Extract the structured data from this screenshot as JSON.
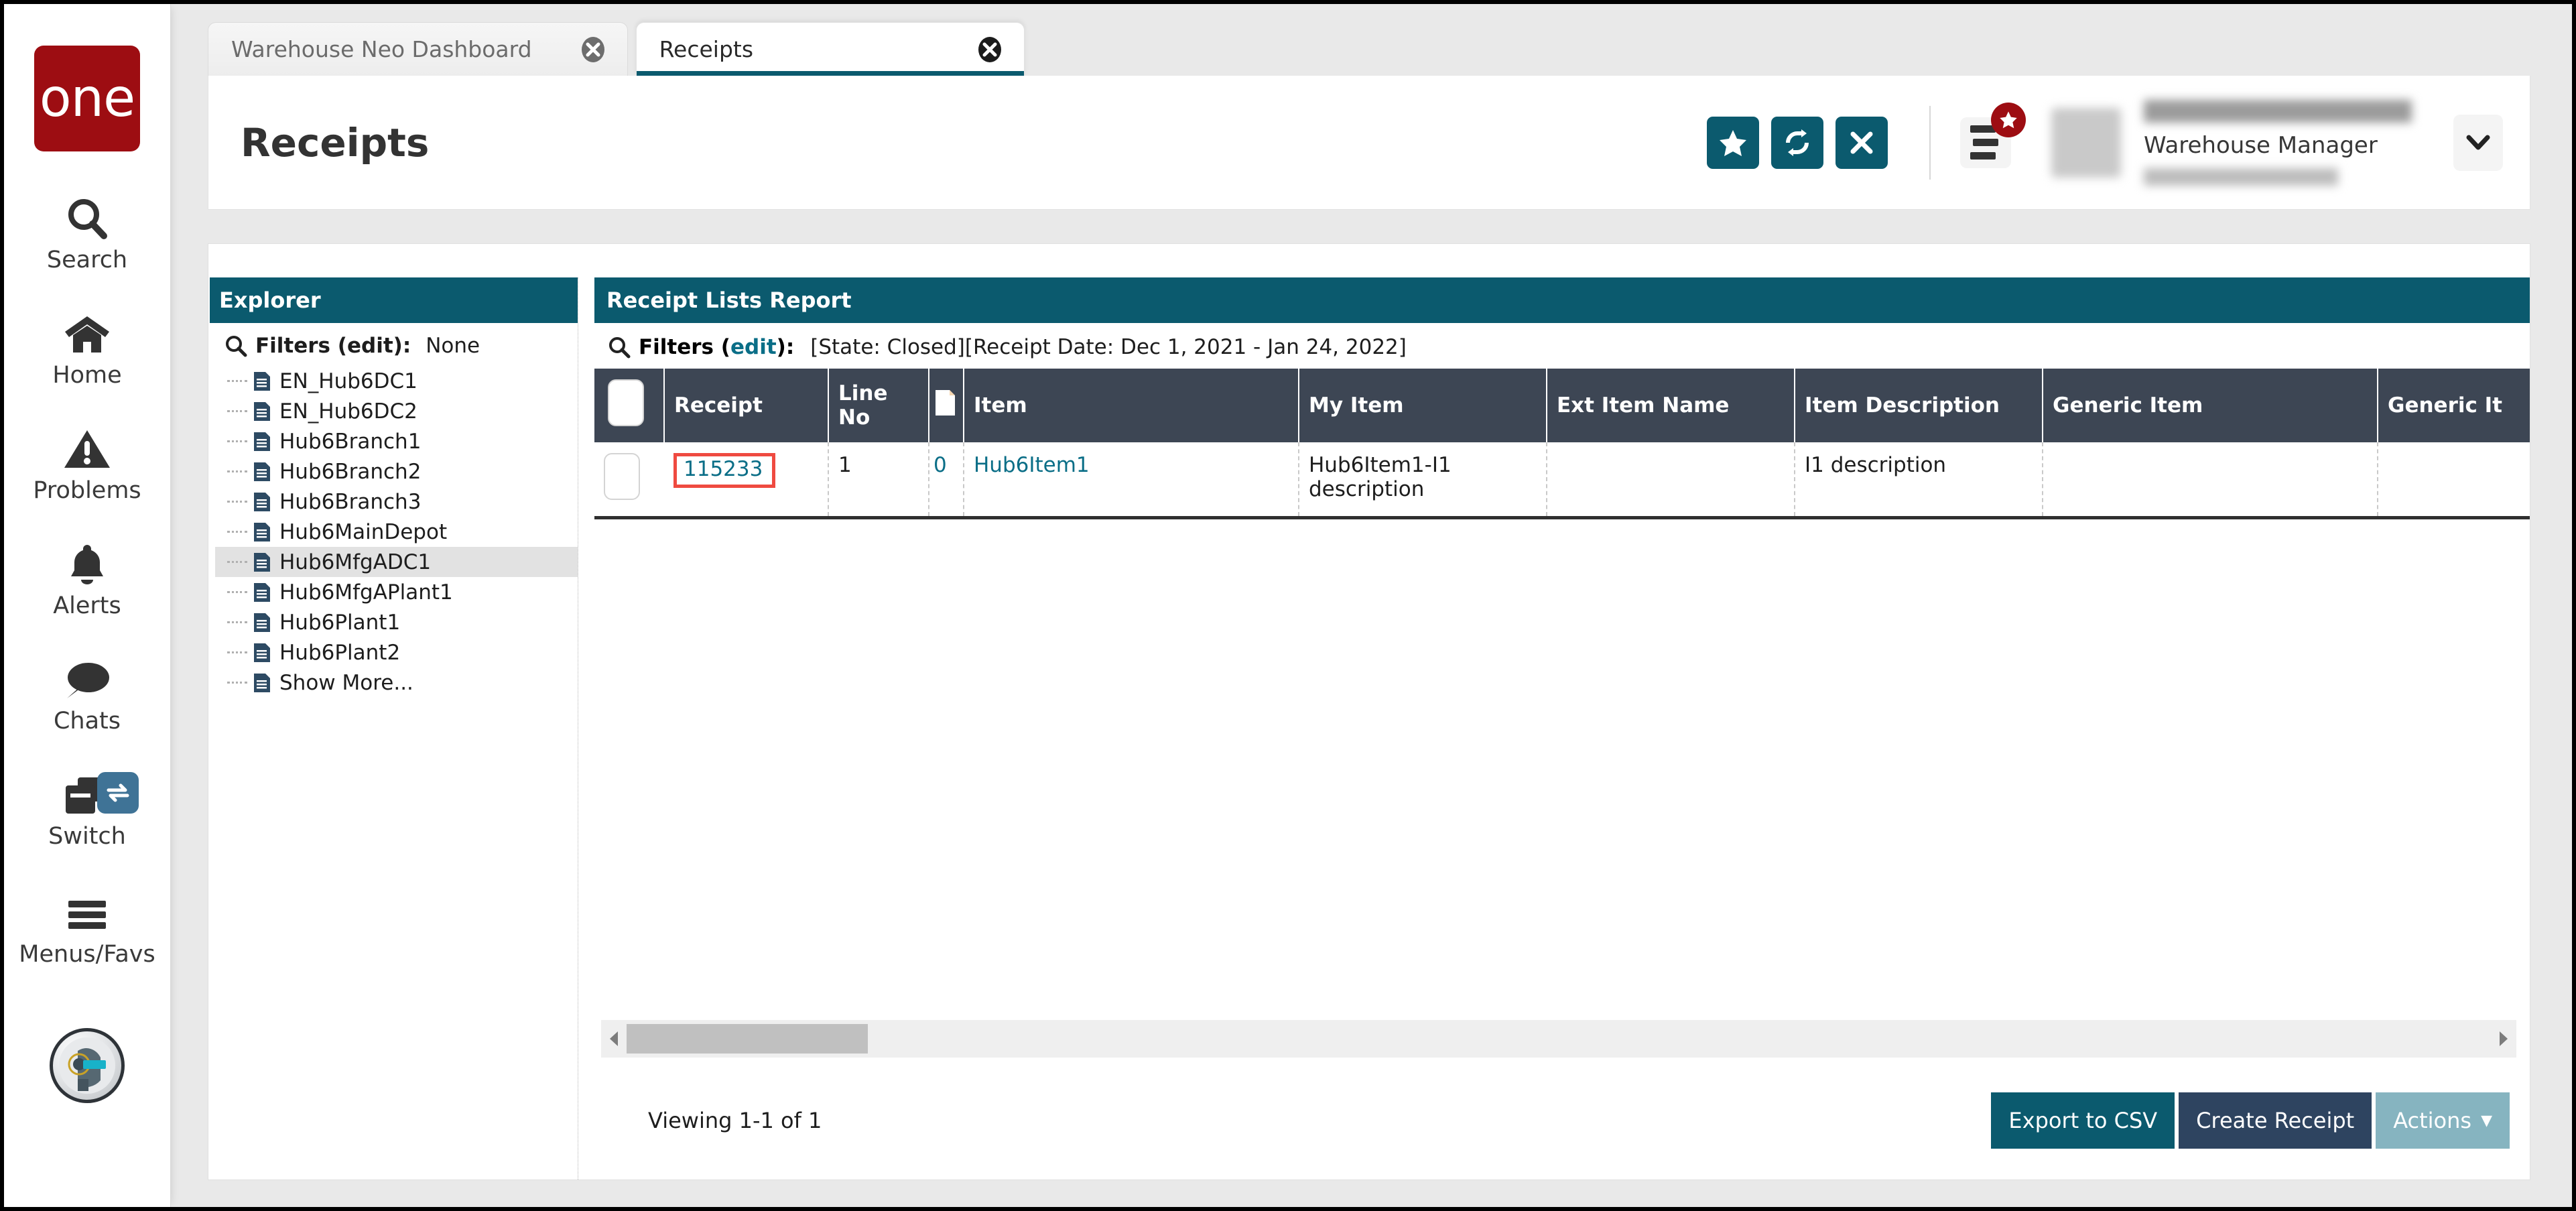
{
  "brand": {
    "logo_text": "one"
  },
  "rail": {
    "items": [
      {
        "label": "Search",
        "icon": "search-icon"
      },
      {
        "label": "Home",
        "icon": "home-icon"
      },
      {
        "label": "Problems",
        "icon": "warning-triangle-icon"
      },
      {
        "label": "Alerts",
        "icon": "bell-icon"
      },
      {
        "label": "Chats",
        "icon": "chat-bubble-icon"
      },
      {
        "label": "Switch",
        "icon": "windows-switch-icon"
      },
      {
        "label": "Menus/Favs",
        "icon": "hamburger-icon"
      }
    ],
    "avatar_icon": "robot-avatar-icon"
  },
  "tabs": [
    {
      "label": "Warehouse Neo Dashboard",
      "active": false
    },
    {
      "label": "Receipts",
      "active": true
    }
  ],
  "header": {
    "title": "Receipts",
    "buttons": [
      {
        "name": "favorite-button",
        "icon": "star-icon"
      },
      {
        "name": "refresh-button",
        "icon": "refresh-icon"
      },
      {
        "name": "close-button",
        "icon": "x-icon"
      }
    ],
    "menu_badge_icon": "star-icon",
    "user": {
      "role": "Warehouse Manager"
    }
  },
  "explorer": {
    "title": "Explorer",
    "filters_label": "Filters (",
    "filters_edit": "edit",
    "filters_suffix": "):",
    "filters_value": "None",
    "items": [
      "EN_Hub6DC1",
      "EN_Hub6DC2",
      "Hub6Branch1",
      "Hub6Branch2",
      "Hub6Branch3",
      "Hub6MainDepot",
      "Hub6MfgADC1",
      "Hub6MfgAPlant1",
      "Hub6Plant1",
      "Hub6Plant2",
      "Show More..."
    ],
    "selected_index": 6
  },
  "report": {
    "title": "Receipt Lists Report",
    "filters_label": "Filters (",
    "filters_edit": "edit",
    "filters_suffix": "):",
    "filters_value": "[State: Closed][Receipt Date: Dec 1, 2021 - Jan 24, 2022]",
    "columns": [
      {
        "key": "select",
        "label": "",
        "icon": "checkbox-icon"
      },
      {
        "key": "receipt",
        "label": "Receipt"
      },
      {
        "key": "line_no",
        "label": "Line No"
      },
      {
        "key": "doc",
        "label": "",
        "icon": "document-icon"
      },
      {
        "key": "item",
        "label": "Item"
      },
      {
        "key": "my_item",
        "label": "My Item"
      },
      {
        "key": "ext_item_name",
        "label": "Ext Item Name"
      },
      {
        "key": "item_description",
        "label": "Item Description"
      },
      {
        "key": "generic_item",
        "label": "Generic Item"
      },
      {
        "key": "generic_item_trunc",
        "label": "Generic It"
      }
    ],
    "rows": [
      {
        "receipt": "115233",
        "receipt_highlighted": true,
        "line_no": "1",
        "doc": "0",
        "item": "Hub6Item1",
        "my_item": "Hub6Item1-I1 description",
        "ext_item_name": "",
        "item_description": "I1 description",
        "generic_item": "",
        "generic_item_trunc": ""
      }
    ],
    "viewing": "Viewing 1-1 of 1",
    "actions": {
      "export_label": "Export to CSV",
      "create_label": "Create Receipt",
      "actions_label": "Actions",
      "actions_caret": "▼"
    }
  },
  "colors": {
    "teal": "#0b5a6e",
    "brand_red": "#9d0d12",
    "table_header": "#3d4654",
    "link": "#0a6e87",
    "highlight_red": "#ef4a40",
    "secondary_btn": "#2e4460",
    "disabled_btn": "#86b4c0"
  }
}
